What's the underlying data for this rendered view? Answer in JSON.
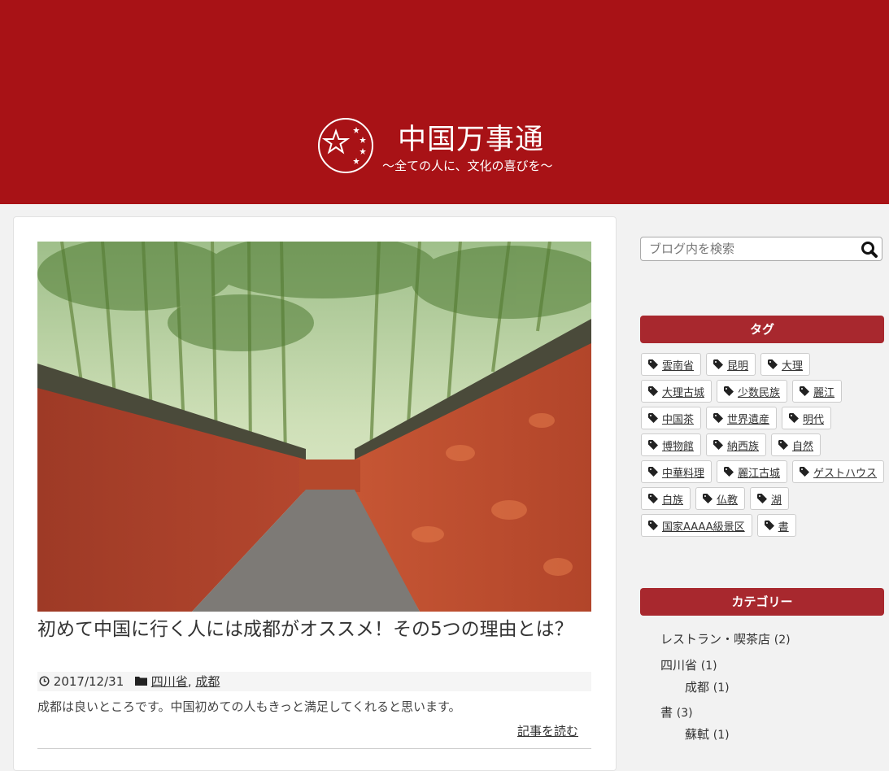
{
  "header": {
    "title": "中国万事通",
    "tagline": "〜全ての人に、文化の喜びを〜",
    "logo_icon": "star-emblem-icon",
    "background_color": "#a81216"
  },
  "post": {
    "image_alt": "成都の竹林と赤い壁の小道",
    "title": "初めて中国に行く人には成都がオススメ！その5つの理由とは？",
    "date": "2017/12/31",
    "date_icon": "clock-icon",
    "category_icon": "folder-icon",
    "categories": [
      "四川省",
      "成都"
    ],
    "category_separator": ", ",
    "excerpt": "成都は良いところです。中国初めての人もきっと満足してくれると思います。",
    "read_more": "記事を読む"
  },
  "search": {
    "placeholder": "ブログ内を検索",
    "icon": "search-icon"
  },
  "tags_widget": {
    "title": "タグ",
    "tag_icon": "tag-icon",
    "tags": [
      "雲南省",
      "昆明",
      "大理",
      "大理古城",
      "少数民族",
      "麗江",
      "中国茶",
      "世界遺産",
      "明代",
      "博物館",
      "納西族",
      "自然",
      "中華料理",
      "麗江古城",
      "ゲストハウス",
      "白族",
      "仏教",
      "湖",
      "国家AAAA級景区",
      "書"
    ]
  },
  "category_widget": {
    "title": "カテゴリー",
    "items": [
      {
        "label": "レストラン・喫茶店",
        "count": "(2)"
      },
      {
        "label": "四川省",
        "count": "(1)"
      },
      {
        "label": "成都",
        "count": "(1)"
      },
      {
        "label": "書",
        "count": "(3)"
      },
      {
        "label": "蘇軾",
        "count": "(1)"
      }
    ]
  },
  "colors": {
    "accent": "#a8282e",
    "page_background": "#f2f2f2"
  }
}
